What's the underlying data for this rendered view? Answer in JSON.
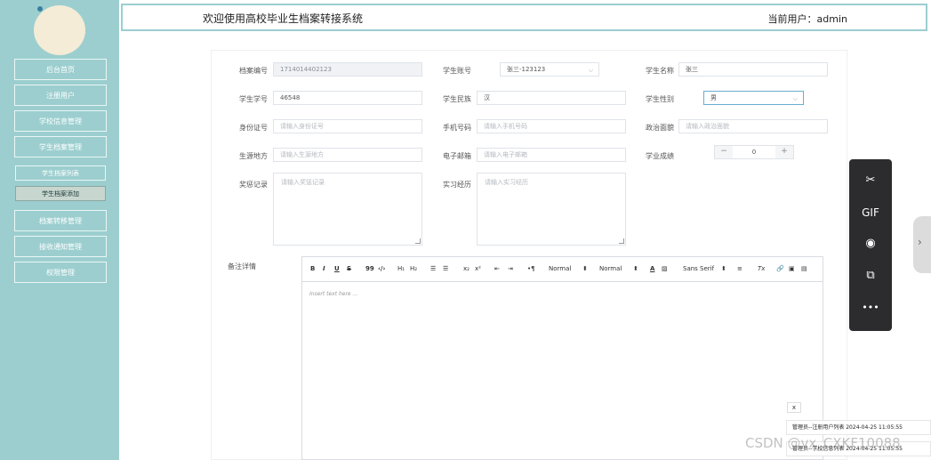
{
  "sidebar": {
    "brand": "",
    "items": [
      {
        "label": "后台首页"
      },
      {
        "label": "注册用户"
      },
      {
        "label": "学校信息管理"
      },
      {
        "label": "学生档案管理"
      },
      {
        "label": "学生档案列表"
      },
      {
        "label": "学生档案添加"
      },
      {
        "label": "档案转移管理"
      },
      {
        "label": "接收通知管理"
      },
      {
        "label": "权限管理"
      }
    ]
  },
  "header": {
    "title": "欢迎使用高校毕业生档案转接系统",
    "current_user": "当前用户：admin"
  },
  "form": {
    "archive_no": {
      "label": "档案编号",
      "value": "1714014402123"
    },
    "student_account": {
      "label": "学生账号",
      "value": "张三-123123"
    },
    "student_name": {
      "label": "学生名称",
      "value": "张三"
    },
    "student_id": {
      "label": "学生学号",
      "value": "46548"
    },
    "ethnicity": {
      "label": "学生民族",
      "value": "汉"
    },
    "gender": {
      "label": "学生性别",
      "value": "男"
    },
    "id_card": {
      "label": "身份证号",
      "placeholder": "请输入身份证号"
    },
    "phone": {
      "label": "手机号码",
      "placeholder": "请输入手机号码"
    },
    "political": {
      "label": "政治面貌",
      "placeholder": "请输入政治面貌"
    },
    "origin": {
      "label": "生源地方",
      "placeholder": "请输入生源地方"
    },
    "email": {
      "label": "电子邮箱",
      "placeholder": "请输入电子邮箱"
    },
    "score": {
      "label": "学业成绩",
      "value": "0",
      "minus": "−",
      "plus": "+"
    },
    "awards": {
      "label": "奖惩记录",
      "placeholder": "请输入奖惩记录"
    },
    "internship": {
      "label": "实习经历",
      "placeholder": "请输入实习经历"
    },
    "remark": {
      "label": "备注详情"
    }
  },
  "editor": {
    "toolbar": {
      "bold": "B",
      "italic": "I",
      "underline": "U",
      "strike": "S",
      "quote": "99",
      "code": "‹/›",
      "h1": "H₁",
      "h2": "H₂",
      "ol": "☰",
      "ul": "☰",
      "sub": "x₂",
      "sup": "x²",
      "indent_l": "⇤",
      "indent_r": "⇥",
      "dir": "•¶",
      "size": "Normal",
      "header": "Normal",
      "color": "A",
      "bg": "▨",
      "font": "Sans Serif",
      "align": "≡",
      "clean": "Tx",
      "link": "🔗",
      "image": "▣",
      "video": "▤"
    },
    "placeholder": "Insert text here ...",
    "close": "x"
  },
  "float_bar": {
    "scissors": "✂",
    "gif": "GIF",
    "record": "◉",
    "screenshot": "⧉",
    "more": "•••"
  },
  "bottom_tabs": [
    {
      "label": "管理员--注册用户列表 2024-04-25 11:05:55"
    },
    {
      "label": "管理员--学校信息列表 2024-04-25 11:05:55"
    }
  ],
  "watermark": "CSDN @vx_CXKF10088"
}
